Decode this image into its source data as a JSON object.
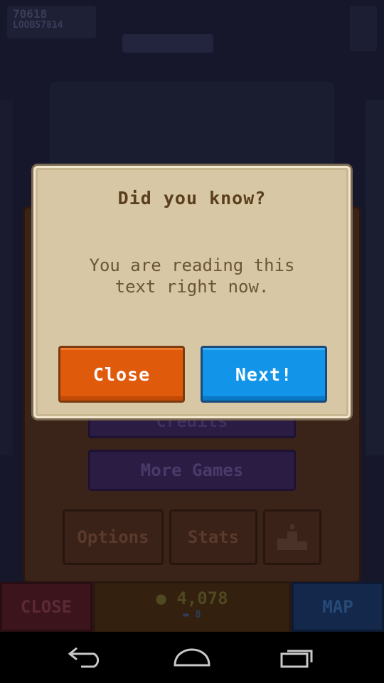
{
  "background": {
    "score_line1": "70618",
    "score_line2": "LOOBS7814",
    "credits_label": "Credits",
    "more_games_label": "More Games",
    "options_label": "Options",
    "stats_label": "Stats",
    "leaderboard_icon": "podium-icon",
    "bottom_close_label": "CLOSE",
    "gold_amount": "4,078",
    "gem_count": "8",
    "map_label": "MAP"
  },
  "dialog": {
    "title": "Did you know?",
    "message": "You are reading this\ntext right now.",
    "close_label": "Close",
    "next_label": "Next!",
    "colors": {
      "panel": "#d7c7a5",
      "close_button": "#e05a0c",
      "next_button": "#1294e8"
    }
  },
  "navbar": {
    "back_icon": "back-icon",
    "home_icon": "home-icon",
    "recents_icon": "recents-icon"
  }
}
